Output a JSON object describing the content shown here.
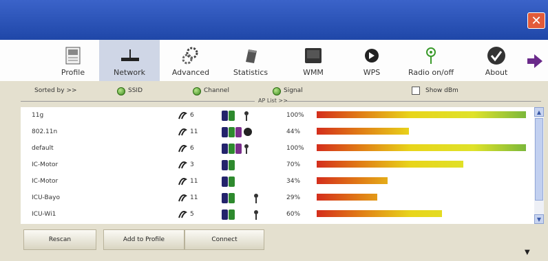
{
  "window": {
    "close_glyph": "✕"
  },
  "toolbar": {
    "items": [
      {
        "label": "Profile",
        "icon": "profile-icon"
      },
      {
        "label": "Network",
        "icon": "network-icon",
        "active": true
      },
      {
        "label": "Advanced",
        "icon": "advanced-icon"
      },
      {
        "label": "Statistics",
        "icon": "statistics-icon"
      },
      {
        "label": "WMM",
        "icon": "wmm-icon"
      },
      {
        "label": "WPS",
        "icon": "wps-icon"
      },
      {
        "label": "Radio on/off",
        "icon": "radio-icon"
      },
      {
        "label": "About",
        "icon": "about-icon"
      }
    ],
    "next_icon": "arrow-right-icon"
  },
  "sortbar": {
    "sorted_by": "Sorted by >>",
    "ssid": "SSID",
    "channel": "Channel",
    "signal": "Signal",
    "show_dbm": "Show dBm",
    "ap_list": "AP List >>"
  },
  "ap_list": [
    {
      "ssid": "11g",
      "channel": "6",
      "signal_pct": 100,
      "signal_label": "100%"
    },
    {
      "ssid": "802.11n",
      "channel": "11",
      "signal_pct": 44,
      "signal_label": "44%"
    },
    {
      "ssid": "default",
      "channel": "6",
      "signal_pct": 100,
      "signal_label": "100%"
    },
    {
      "ssid": "IC-Motor",
      "channel": "3",
      "signal_pct": 70,
      "signal_label": "70%"
    },
    {
      "ssid": "IC-Motor",
      "channel": "11",
      "signal_pct": 34,
      "signal_label": "34%"
    },
    {
      "ssid": "ICU-Bayo",
      "channel": "11",
      "signal_pct": 29,
      "signal_label": "29%"
    },
    {
      "ssid": "ICU-Wi1",
      "channel": "5",
      "signal_pct": 60,
      "signal_label": "60%"
    }
  ],
  "buttons": {
    "rescan": "Rescan",
    "add_to_profile": "Add to Profile",
    "connect": "Connect"
  },
  "scroll": {
    "up": "▲",
    "down": "▼"
  },
  "footer": {
    "arrow": "▼"
  }
}
